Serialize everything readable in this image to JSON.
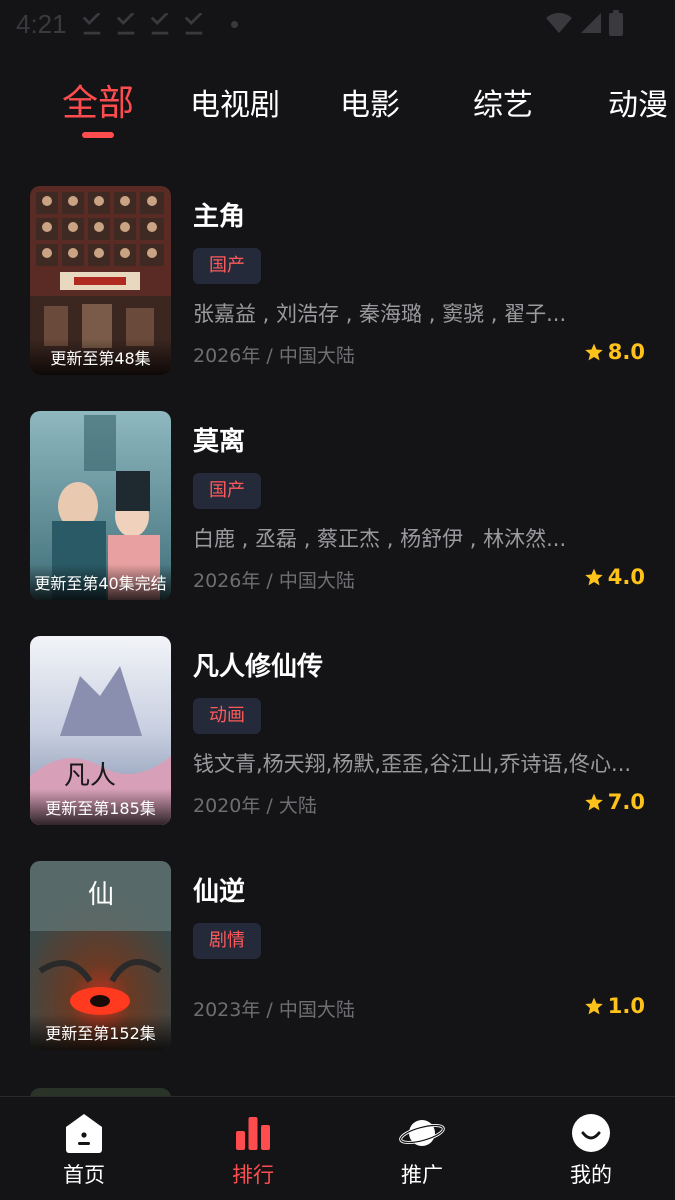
{
  "status_bar": {
    "time": "4:21"
  },
  "tabs": [
    {
      "label": "全部",
      "active": true
    },
    {
      "label": "电视剧"
    },
    {
      "label": "电影"
    },
    {
      "label": "综艺"
    },
    {
      "label": "动漫"
    }
  ],
  "items": [
    {
      "title": "主角",
      "tag": "国产",
      "cast": "张嘉益 , 刘浩存 , 秦海璐 , 窦骁 , 翟子...",
      "meta": "2026年 / 中国大陆",
      "rating": "8.0",
      "update": "更新至第48集"
    },
    {
      "title": "莫离",
      "tag": "国产",
      "cast": "白鹿 , 丞磊 , 蔡正杰 , 杨舒伊 , 林沐然...",
      "meta": "2026年 / 中国大陆",
      "rating": "4.0",
      "update": "更新至第40集完结"
    },
    {
      "title": "凡人修仙传",
      "tag": "动画",
      "cast": "钱文青,杨天翔,杨默,歪歪,谷江山,乔诗语,佟心...",
      "meta": "2020年 / 大陆",
      "rating": "7.0",
      "update": "更新至第185集"
    },
    {
      "title": "仙逆",
      "tag": "剧情",
      "cast": "",
      "meta": "2023年 / 中国大陆",
      "rating": "1.0",
      "update": "更新至第152集"
    }
  ],
  "bottom_nav": [
    {
      "label": "首页",
      "icon": "home-icon"
    },
    {
      "label": "排行",
      "icon": "ranking-icon",
      "active": true
    },
    {
      "label": "推广",
      "icon": "planet-icon"
    },
    {
      "label": "我的",
      "icon": "profile-icon"
    }
  ],
  "colors": {
    "accent": "#ff4d4f",
    "rating": "#ffc21a",
    "background": "#141416",
    "tag_bg": "#252a3a"
  }
}
